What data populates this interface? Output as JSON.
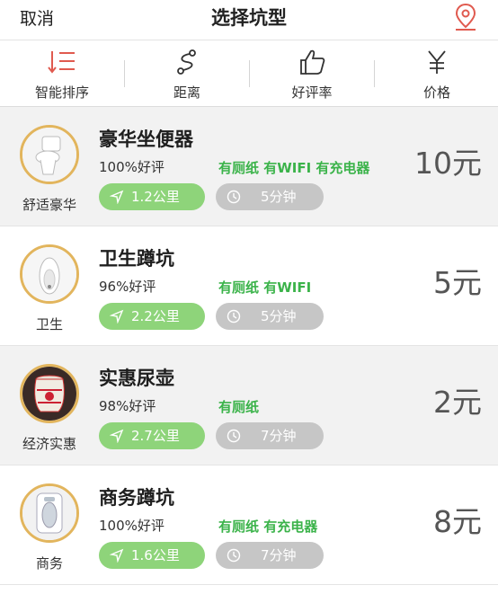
{
  "header": {
    "cancel": "取消",
    "title": "选择坑型",
    "location_icon": "map-pin-icon"
  },
  "sort_options": [
    {
      "label": "智能排序",
      "icon": "sort-list-icon",
      "active": true
    },
    {
      "label": "距离",
      "icon": "route-icon",
      "active": false
    },
    {
      "label": "好评率",
      "icon": "thumbs-up-icon",
      "active": false
    },
    {
      "label": "价格",
      "icon": "yen-icon",
      "active": false
    }
  ],
  "toilets": [
    {
      "type_label": "舒适豪华",
      "name": "豪华坐便器",
      "rating": "100%好评",
      "amenities": "有厕纸 有WIFI 有充电器",
      "distance": "1.2公里",
      "time": "5分钟",
      "price": "10元"
    },
    {
      "type_label": "卫生",
      "name": "卫生蹲坑",
      "rating": "96%好评",
      "amenities": "有厕纸 有WIFI",
      "distance": "2.2公里",
      "time": "5分钟",
      "price": "5元"
    },
    {
      "type_label": "经济实惠",
      "name": "实惠尿壶",
      "rating": "98%好评",
      "amenities": "有厕纸",
      "distance": "2.7公里",
      "time": "7分钟",
      "price": "2元"
    },
    {
      "type_label": "商务",
      "name": "商务蹲坑",
      "rating": "100%好评",
      "amenities": "有厕纸 有充电器",
      "distance": "1.6公里",
      "time": "7分钟",
      "price": "8元"
    }
  ],
  "colors": {
    "green_text": "#3bb34a",
    "distance_pill": "#8ed47a",
    "time_pill": "#c6c6c6",
    "accent_red": "#e05a4f",
    "thumb_border": "#e2b55d"
  }
}
